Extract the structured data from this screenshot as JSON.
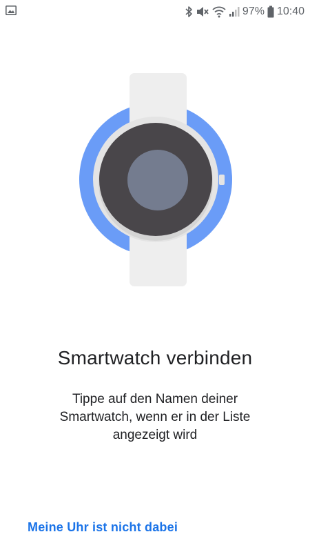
{
  "status_bar": {
    "battery_percent": "97%",
    "time": "10:40",
    "icons": [
      "image-notification-icon",
      "bluetooth-icon",
      "mute-icon",
      "wifi-icon",
      "signal-icon",
      "battery-icon"
    ]
  },
  "illustration": {
    "icon": "smartwatch-illustration",
    "colors": {
      "ring": "#6a9cf7",
      "band": "#eeeeee",
      "bezel": "#e4e4e4",
      "face": "#49464a",
      "center": "#747c8f"
    }
  },
  "content": {
    "title": "Smartwatch verbinden",
    "subtitle": "Tippe auf den Namen deiner\nSmartwatch, wenn er in der Liste\nangezeigt wird"
  },
  "actions": {
    "not_listed_label": "Meine Uhr ist nicht dabei",
    "accent_color": "#1a73e8"
  }
}
